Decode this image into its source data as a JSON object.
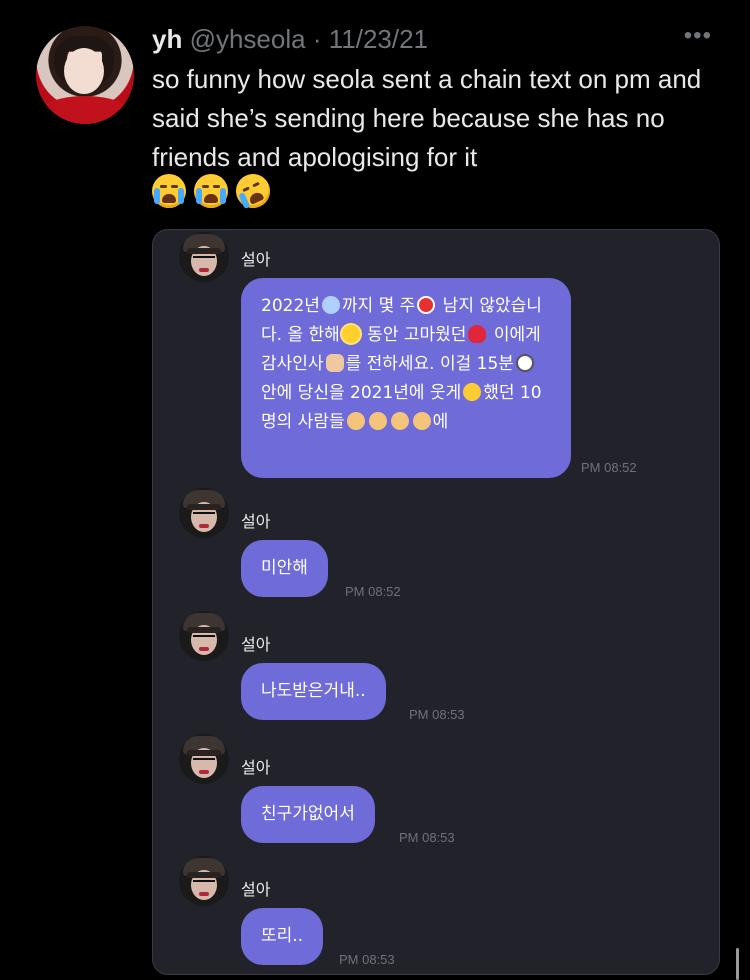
{
  "tweet": {
    "display_name": "yh",
    "handle": "@yhseola",
    "separator": "·",
    "date": "11/23/21",
    "more_label": "•••",
    "text": "so funny how seola sent a chain text on pm and said she’s sending here because she has no friends and apologising for it",
    "emojis": [
      "loudly-crying-face",
      "loudly-crying-face",
      "rolling-on-the-floor-laughing"
    ]
  },
  "chat": {
    "background": "#22232a",
    "bubble_color": "#6f6bd8",
    "messages": [
      {
        "sender": "설아",
        "text_parts": [
          "2022년",
          "까지 몇 주",
          " 남지 않았습니다. 올 한해",
          " 동안 고마웠던",
          " 이에게 감사인사",
          "를 전하세요. 이걸 15분",
          " 안에 당신을 2021년에 웃게",
          "했던 10명의 사람들",
          "에"
        ],
        "time": "PM 08:52"
      },
      {
        "sender": "설아",
        "text": "미안해",
        "time": "PM 08:52"
      },
      {
        "sender": "설아",
        "text": "나도받은거내..",
        "time": "PM 08:53"
      },
      {
        "sender": "설아",
        "text": "친구가없어서",
        "time": "PM 08:53"
      },
      {
        "sender": "설아",
        "text": "또리..",
        "time": "PM 08:53"
      }
    ]
  }
}
